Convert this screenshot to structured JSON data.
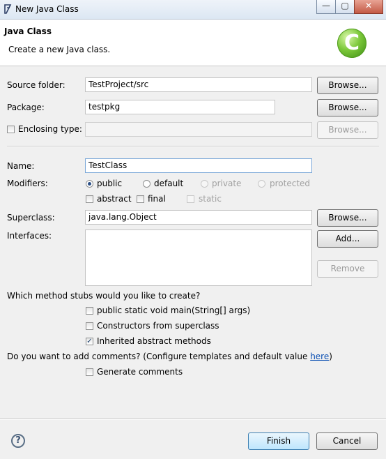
{
  "window": {
    "title": "New Java Class",
    "controls": {
      "minimize": "—",
      "maximize": "▢",
      "close": "✕"
    }
  },
  "header": {
    "title": "Java Class",
    "subtitle": "Create a new Java class.",
    "logo_letter": "C"
  },
  "form": {
    "source_folder": {
      "label": "Source folder:",
      "value": "TestProject/src",
      "button": "Browse..."
    },
    "package": {
      "label": "Package:",
      "value": "testpkg",
      "button": "Browse..."
    },
    "enclosing_type": {
      "label": "Enclosing type:",
      "value": "",
      "checked": false,
      "button": "Browse..."
    },
    "name": {
      "label": "Name:",
      "value": "TestClass"
    },
    "modifiers": {
      "label": "Modifiers:",
      "access": [
        {
          "label": "public",
          "selected": true,
          "enabled": true
        },
        {
          "label": "default",
          "selected": false,
          "enabled": true
        },
        {
          "label": "private",
          "selected": false,
          "enabled": false
        },
        {
          "label": "protected",
          "selected": false,
          "enabled": false
        }
      ],
      "flags": [
        {
          "label": "abstract",
          "checked": false,
          "enabled": true
        },
        {
          "label": "final",
          "checked": false,
          "enabled": true
        },
        {
          "label": "static",
          "checked": false,
          "enabled": false
        }
      ]
    },
    "superclass": {
      "label": "Superclass:",
      "value": "java.lang.Object",
      "button": "Browse..."
    },
    "interfaces": {
      "label": "Interfaces:",
      "add_button": "Add...",
      "remove_button": "Remove"
    }
  },
  "stubs": {
    "question": "Which method stubs would you like to create?",
    "options": [
      {
        "label": "public static void main(String[] args)",
        "checked": false
      },
      {
        "label": "Constructors from superclass",
        "checked": false
      },
      {
        "label": "Inherited abstract methods",
        "checked": true
      }
    ]
  },
  "comments": {
    "question_prefix": "Do you want to add comments? (Configure templates and default value ",
    "link": "here",
    "question_suffix": ")",
    "option": {
      "label": "Generate comments",
      "checked": false
    }
  },
  "footer": {
    "help": "?",
    "finish": "Finish",
    "cancel": "Cancel"
  },
  "check_mark": "✓"
}
